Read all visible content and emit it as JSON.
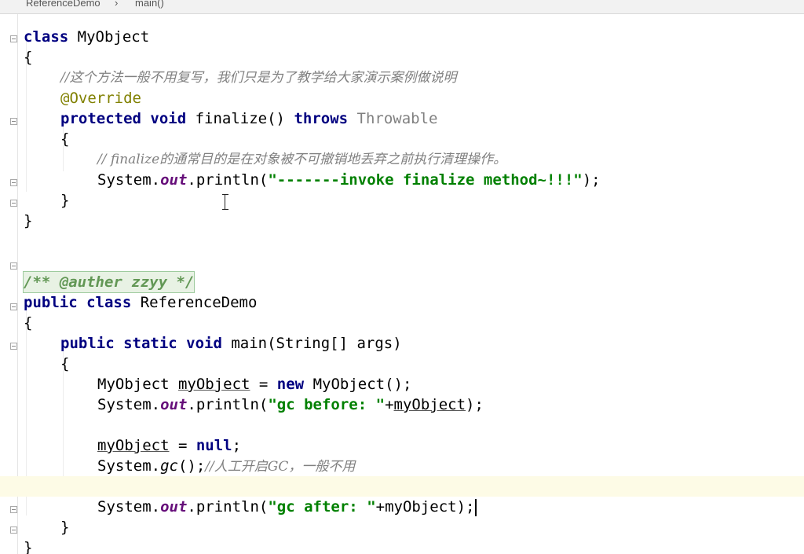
{
  "breadcrumb": {
    "file": "ReferenceDemo",
    "separator": "›",
    "method": "main()"
  },
  "code": {
    "l1_class": "class",
    "l1_name": " MyObject",
    "l2_brace": "{",
    "l3_comment": "//这个方法一般不用复写，我们只是为了教学给大家演示案例做说明",
    "l4_annotation": "@Override",
    "l5_protected": "protected",
    "l5_void": " void",
    "l5_method": " finalize()",
    "l5_throws": " throws",
    "l5_type": " Throwable",
    "l6_brace": "{",
    "l7_comment": "// finalize的通常目的是在对象被不可撤销地丢弃之前执行清理操作。",
    "l8_system": "System.",
    "l8_out": "out",
    "l8_println": ".println(",
    "l8_string": "\"-------invoke finalize method~!!!\"",
    "l8_end": ");",
    "l9_brace": "}",
    "l10_brace": "}",
    "l11_doc": "/** @auther zzyy */",
    "l12_public": "public",
    "l12_class": " class",
    "l12_name": " ReferenceDemo",
    "l13_brace": "{",
    "l14_mods": "public static void",
    "l14_sig": " main(String[] args)",
    "l15_brace": "{",
    "l16_type": "MyObject ",
    "l16_var": "myObject",
    "l16_eq": " = ",
    "l16_new": "new",
    "l16_ctor": " MyObject();",
    "l17_system": "System.",
    "l17_out": "out",
    "l17_println": ".println(",
    "l17_string": "\"gc before: \"",
    "l17_plus": "+",
    "l17_var": "myObject",
    "l17_end": ");",
    "l18_var": "myObject",
    "l18_eq": " = ",
    "l18_null": "null",
    "l18_semi": ";",
    "l19_system": "System.",
    "l19_gc": "gc",
    "l19_call": "();",
    "l19_comment": "//人工开启GC，一般不用",
    "l20_system": "System.",
    "l20_out": "out",
    "l20_println": ".println(",
    "l20_string": "\"gc after: \"",
    "l20_plus": "+",
    "l20_var": "myObject",
    "l20_end": ");",
    "l21_brace": "}",
    "l22_brace": "}"
  },
  "colors": {
    "keyword": "#000080",
    "string": "#008000",
    "comment": "#808080",
    "annotation": "#808000",
    "static_field": "#660e7a",
    "doc_comment": "#629755",
    "caret_row": "#fdfbe6"
  }
}
